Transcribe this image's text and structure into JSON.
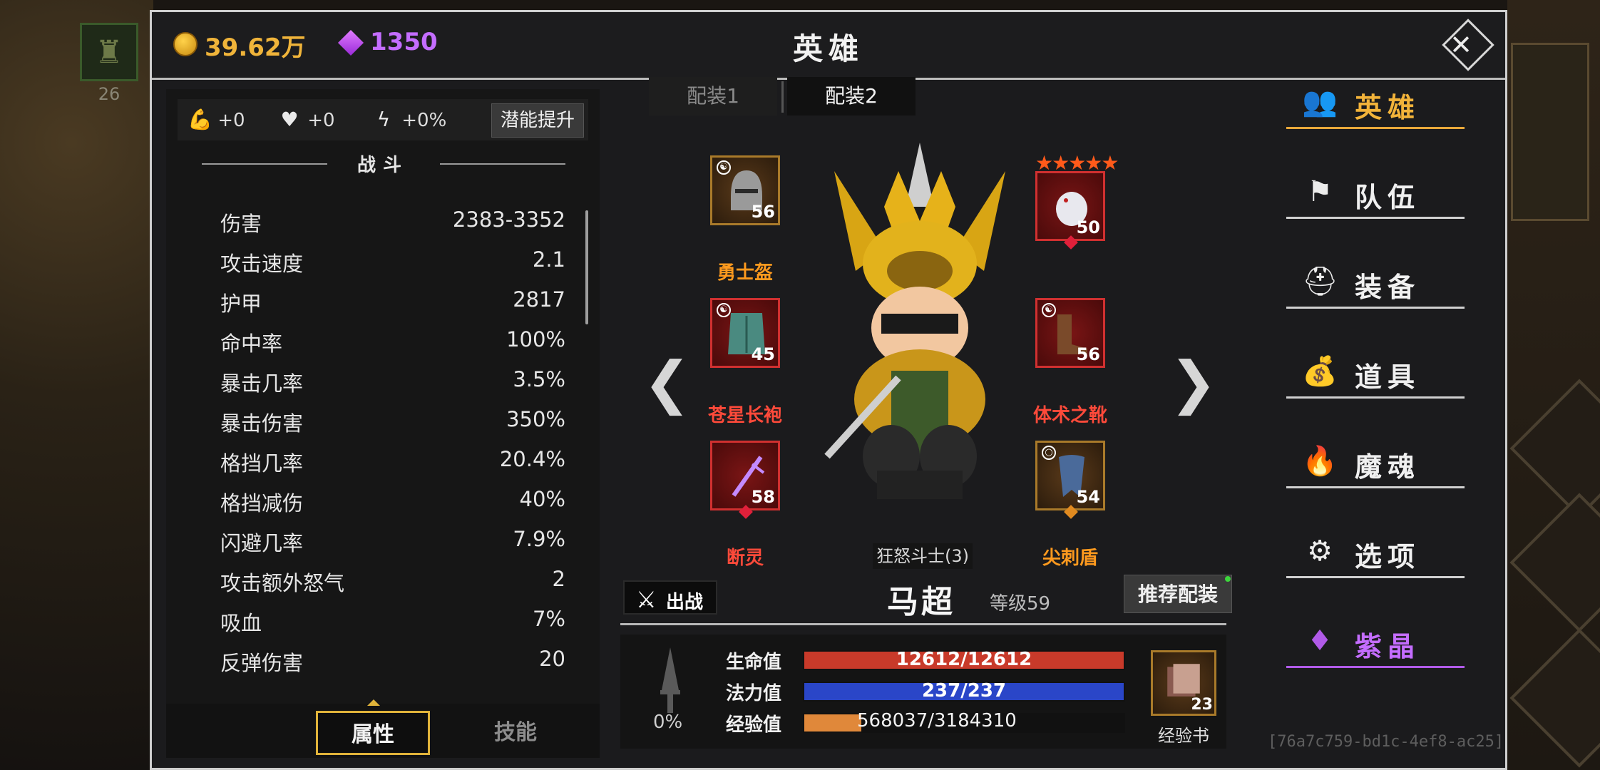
{
  "background": {
    "left_slot_count": "26"
  },
  "header": {
    "gold": "39.62万",
    "gems": "1350",
    "title": "英雄"
  },
  "potential": {
    "strength": "+0",
    "health": "+0",
    "energy": "+0%",
    "button": "潜能提升"
  },
  "stats_section": "战斗",
  "stats": [
    {
      "name": "伤害",
      "value": "2383-3352"
    },
    {
      "name": "攻击速度",
      "value": "2.1"
    },
    {
      "name": "护甲",
      "value": "2817"
    },
    {
      "name": "命中率",
      "value": "100%"
    },
    {
      "name": "暴击几率",
      "value": "3.5%"
    },
    {
      "name": "暴击伤害",
      "value": "350%"
    },
    {
      "name": "格挡几率",
      "value": "20.4%"
    },
    {
      "name": "格挡减伤",
      "value": "40%"
    },
    {
      "name": "闪避几率",
      "value": "7.9%"
    },
    {
      "name": "攻击额外怒气",
      "value": "2"
    },
    {
      "name": "吸血",
      "value": "7%"
    },
    {
      "name": "反弹伤害",
      "value": "20"
    }
  ],
  "bottom_tabs": {
    "attributes": "属性",
    "skills": "技能"
  },
  "loadouts": [
    "配装1",
    "配装2"
  ],
  "equipment": {
    "helmet": {
      "name": "勇士盔",
      "level": "56",
      "mark": "☯"
    },
    "pet": {
      "level": "50",
      "stars": "★★★★★"
    },
    "robe": {
      "name": "苍星长袍",
      "level": "45",
      "mark": "☯"
    },
    "boots": {
      "name": "体术之靴",
      "level": "56",
      "mark": "☯"
    },
    "weapon": {
      "name": "断灵",
      "level": "58"
    },
    "shield": {
      "name": "尖刺盾",
      "level": "54",
      "mark": "○"
    }
  },
  "hero": {
    "class": "狂怒斗士(3)",
    "name": "马超",
    "level": "等级59",
    "deploy": "出战",
    "recommend": "推荐配装"
  },
  "bars": {
    "rage_pct": "0%",
    "hp_label": "生命值",
    "hp_text": "12612/12612",
    "hp_fill": 1.0,
    "mp_label": "法力值",
    "mp_text": "237/237",
    "mp_fill": 1.0,
    "exp_label": "经验值",
    "exp_text": "568037/3184310",
    "exp_fill": 0.178
  },
  "exp_book": {
    "count": "23",
    "name": "经验书"
  },
  "nav": [
    {
      "label": "英雄",
      "icon": "users-icon"
    },
    {
      "label": "队伍",
      "icon": "flag-icon"
    },
    {
      "label": "装备",
      "icon": "helmet-icon"
    },
    {
      "label": "道具",
      "icon": "bag-icon"
    },
    {
      "label": "魔魂",
      "icon": "flame-icon"
    },
    {
      "label": "选项",
      "icon": "gear-icon"
    },
    {
      "label": "紫晶",
      "icon": "gem-icon"
    }
  ],
  "watermark": "[76a7c759-bd1c-4ef8-ac25]",
  "colors": {
    "gold": "#f0b43a",
    "gem": "#c46dff",
    "hp": "#c83a2a",
    "mp": "#2a46c8",
    "exp": "#e0883a",
    "accent": "#e8a83a"
  }
}
